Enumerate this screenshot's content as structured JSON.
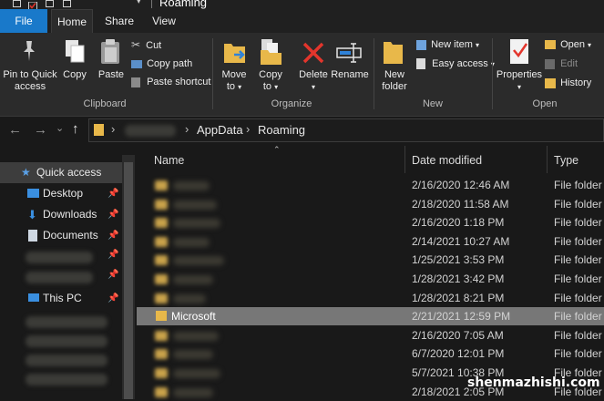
{
  "window": {
    "title": "Roaming"
  },
  "tabs": [
    "File",
    "Home",
    "Share",
    "View"
  ],
  "ribbon": {
    "clipboard": {
      "group_label": "Clipboard",
      "pin": [
        "Pin to Quick",
        "access"
      ],
      "copy": "Copy",
      "paste": "Paste",
      "cut": "Cut",
      "copy_path": "Copy path",
      "paste_shortcut": "Paste shortcut"
    },
    "organize": {
      "group_label": "Organize",
      "move": [
        "Move",
        "to"
      ],
      "copy": [
        "Copy",
        "to"
      ],
      "delete": "Delete",
      "rename": "Rename"
    },
    "new": {
      "group_label": "New",
      "new_folder": [
        "New",
        "folder"
      ],
      "new_item": "New item",
      "easy_access": "Easy access"
    },
    "open": {
      "group_label": "Open",
      "properties": "Properties",
      "open": "Open",
      "edit": "Edit",
      "history": "History"
    }
  },
  "address": {
    "crumbs": [
      "AppData",
      "Roaming"
    ]
  },
  "nav": {
    "quick_access": "Quick access",
    "desktop": "Desktop",
    "downloads": "Downloads",
    "documents": "Documents",
    "this_pc": "This PC"
  },
  "columns": {
    "name": "Name",
    "date": "Date modified",
    "type": "Type"
  },
  "files": [
    {
      "date": "2/16/2020 12:46 AM",
      "type": "File folder"
    },
    {
      "date": "2/18/2020 11:58 AM",
      "type": "File folder"
    },
    {
      "date": "2/16/2020 1:18 PM",
      "type": "File folder"
    },
    {
      "date": "2/14/2021 10:27 AM",
      "type": "File folder"
    },
    {
      "date": "1/25/2021 3:53 PM",
      "type": "File folder"
    },
    {
      "date": "1/28/2021 3:42 PM",
      "type": "File folder"
    },
    {
      "date": "1/28/2021 8:21 PM",
      "type": "File folder"
    },
    {
      "name": "Microsoft",
      "date": "2/21/2021 12:59 PM",
      "type": "File folder"
    },
    {
      "date": "2/16/2020 7:05 AM",
      "type": "File folder"
    },
    {
      "date": "6/7/2020 12:01 PM",
      "type": "File folder"
    },
    {
      "date": "5/7/2021 10:38 PM",
      "type": "File folder"
    },
    {
      "date": "2/18/2021 2:05 PM",
      "type": "File folder"
    }
  ],
  "watermark": "shenmazhishi.com",
  "colors": {
    "accent": "#1979ca",
    "folder": "#e8b84a",
    "delete_red": "#e3352c",
    "selected_row": "#777777"
  }
}
